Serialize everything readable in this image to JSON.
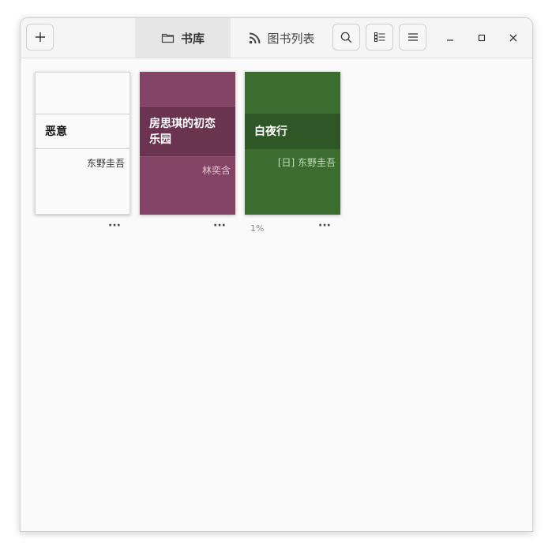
{
  "header": {
    "tabs": [
      {
        "label": "书库",
        "icon": "folder-icon",
        "active": true
      },
      {
        "label": "图书列表",
        "icon": "rss-feed-icon",
        "active": false
      }
    ]
  },
  "books": [
    {
      "title": "恶意",
      "author": "东野圭吾",
      "progress": "",
      "colors": {
        "top": "#ffffff",
        "band": "#ffffff",
        "bottom": "#ffffff",
        "text": "#111111",
        "author": "#333333"
      }
    },
    {
      "title": "房思琪的初恋乐园",
      "author": "林奕含",
      "progress": "",
      "colors": {
        "top": "#834364",
        "band": "#6a3350",
        "bottom": "#834364",
        "text": "#ffffff",
        "author": "#e0c8d4"
      }
    },
    {
      "title": "白夜行",
      "author": "[日] 东野圭吾",
      "progress": "1%",
      "colors": {
        "top": "#3b6e2e",
        "band": "#2e5626",
        "bottom": "#3b6e2e",
        "text": "#ffffff",
        "author": "#c8dcc0"
      }
    }
  ],
  "more_label": "···"
}
